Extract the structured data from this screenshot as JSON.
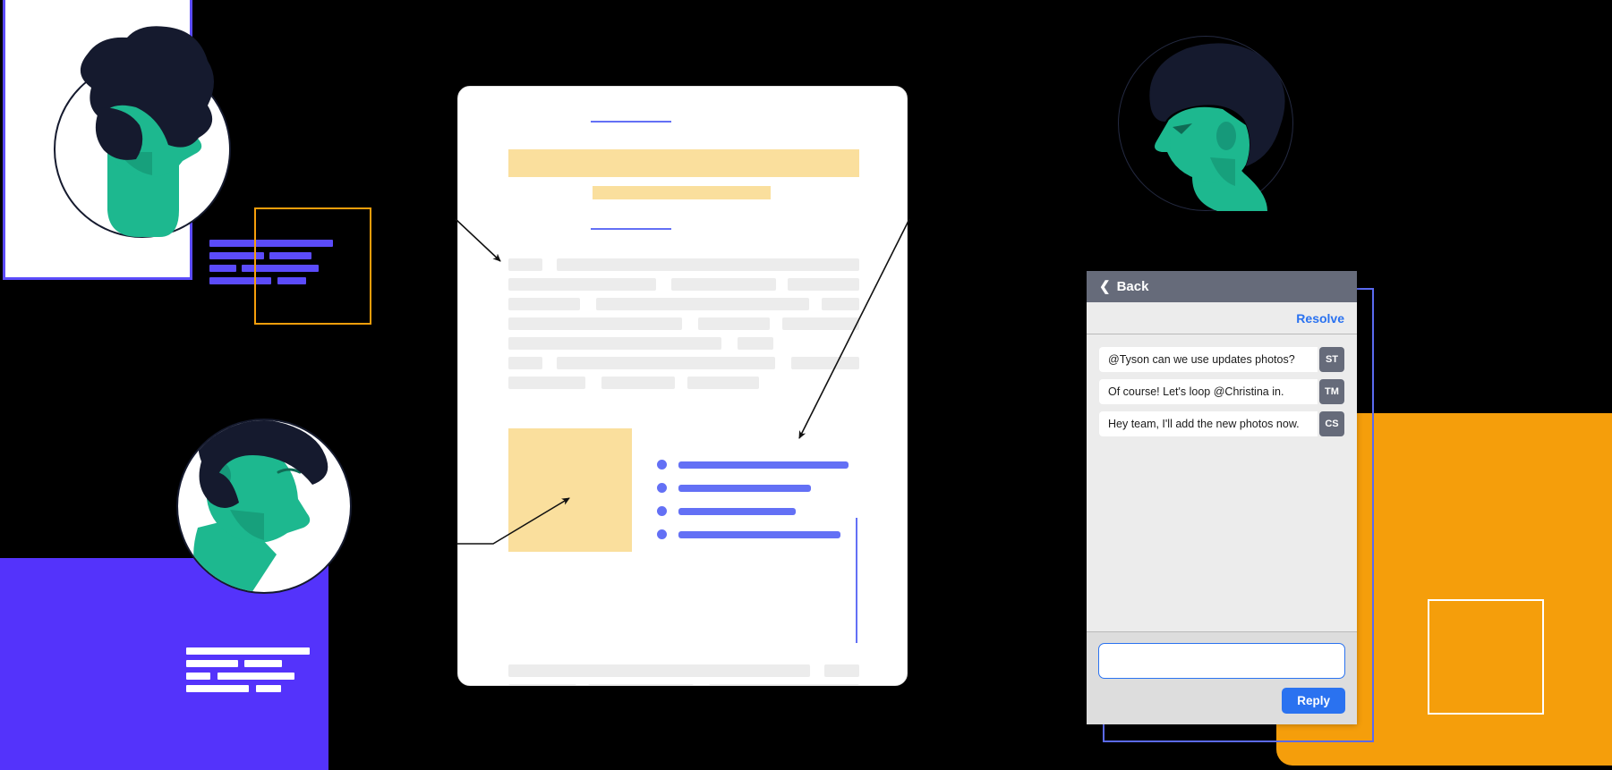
{
  "chat": {
    "back_label": "Back",
    "back_icon": "chevron-left-icon",
    "resolve_label": "Resolve",
    "messages": [
      {
        "text": "@Tyson can we use updates photos?",
        "initials": "ST"
      },
      {
        "text": "Of course! Let's loop @Christina in.",
        "initials": "TM"
      },
      {
        "text": "Hey team, I'll add the new photos now.",
        "initials": "CS"
      }
    ],
    "reply_input_value": "",
    "reply_input_placeholder": "",
    "reply_button_label": "Reply"
  },
  "colors": {
    "header_gray": "#666b7a",
    "panel_gray": "#ececec",
    "footer_gray": "#dddddd",
    "accent_blue": "#2a72f0",
    "doc_blue": "#6370f5",
    "highlight_yellow": "#fadf9d",
    "card_purple": "#5433fb",
    "card_orange": "#f59e0b",
    "outline_orange": "#f59e0b",
    "skin_green": "#1db88f",
    "hair_navy": "#151a2e",
    "placeholder_gray": "#ececec"
  },
  "document": {
    "title_rule": "divider",
    "highlight_bars": 2,
    "bullet_items": 4
  },
  "illustration": {
    "avatars": [
      "avatar-profile-left",
      "avatar-profile-bottom-left",
      "avatar-profile-top-right"
    ],
    "text_bar_groups": [
      "blue-bars-top-left",
      "white-bars-purple-card"
    ],
    "shapes": [
      "orange-outline-rect",
      "purple-card",
      "orange-card",
      "white-square-outline",
      "blue-outline-rect"
    ]
  }
}
